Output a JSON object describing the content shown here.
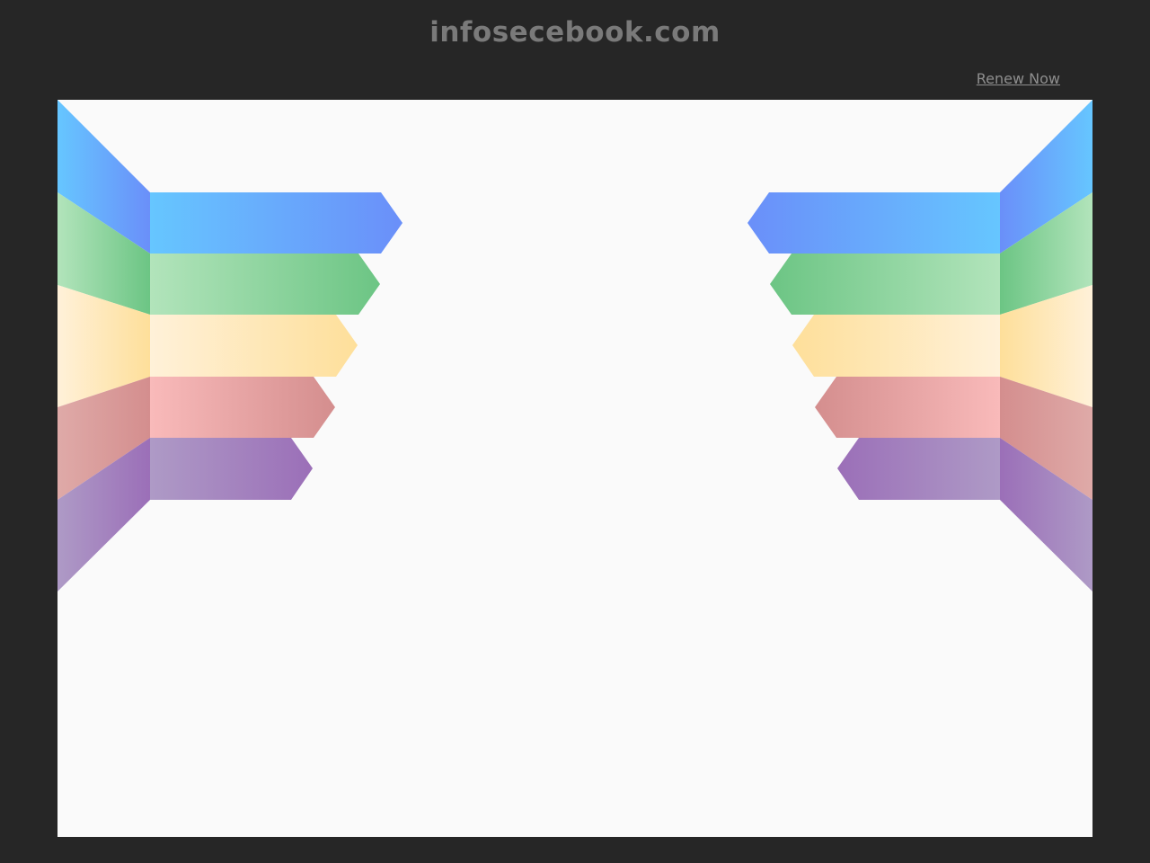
{
  "header": {
    "domain_title": "infosecebook.com",
    "renew_label": "Renew Now"
  },
  "illustration": {
    "name": "ribbon-banners",
    "colors": {
      "blue": [
        "#66c6ff",
        "#6a8ff9"
      ],
      "green": [
        "#b2e4bb",
        "#6cc584"
      ],
      "yellow": [
        "#fff1d9",
        "#fedf9a"
      ],
      "red": [
        "#f9baba",
        "#d48e8e"
      ],
      "purple": [
        "#ae9ac6",
        "#9b6fb8"
      ]
    }
  }
}
